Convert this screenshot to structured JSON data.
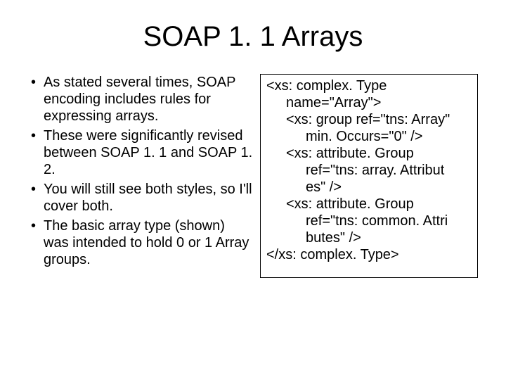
{
  "title": "SOAP 1. 1 Arrays",
  "bullets": [
    "As stated several times, SOAP encoding includes rules for expressing arrays.",
    "These were significantly revised between SOAP 1. 1 and SOAP 1. 2.",
    "You will still see both styles, so I'll cover both.",
    "The basic array type (shown) was intended to hold 0 or 1 Array groups."
  ],
  "code": {
    "line1a": "<xs: complex. Type",
    "line1b": "name=\"Array\">",
    "line2a": "<xs: group ref=\"tns: Array\"",
    "line2b": "min. Occurs=\"0\" />",
    "line3a": "<xs: attribute. Group",
    "line3b": "ref=\"tns: array. Attribut",
    "line3c": "es\" />",
    "line4a": "<xs: attribute. Group",
    "line4b": "ref=\"tns: common. Attri",
    "line4c": "butes\" />",
    "line5": "</xs: complex. Type>"
  }
}
